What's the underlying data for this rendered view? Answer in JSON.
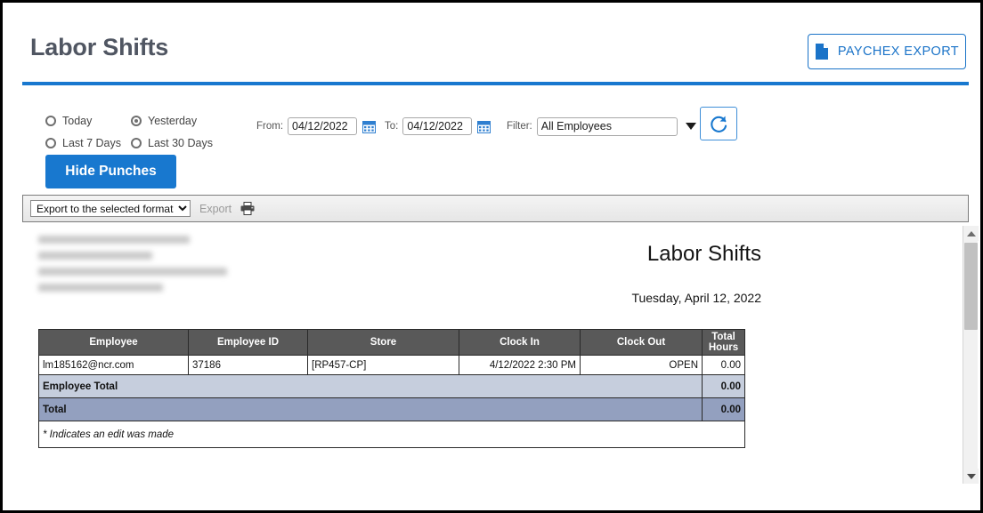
{
  "header": {
    "title": "Labor Shifts",
    "export_button": {
      "label": "PAYCHEX EXPORT",
      "icon": "file-icon"
    },
    "accent_color": "#1878cf",
    "title_color": "#505662"
  },
  "filters": {
    "range_options": [
      {
        "label": "Today",
        "selected": false
      },
      {
        "label": "Yesterday",
        "selected": true
      },
      {
        "label": "Last 7 Days",
        "selected": false
      },
      {
        "label": "Last 30 Days",
        "selected": false
      }
    ],
    "from_label": "From:",
    "from_value": "04/12/2022",
    "to_label": "To:",
    "to_value": "04/12/2022",
    "filter_label": "Filter:",
    "filter_value": "All Employees",
    "refresh_icon": "refresh-icon",
    "calendar_icon": "calendar-icon",
    "hide_punches_label": "Hide Punches"
  },
  "export_toolbar": {
    "format_select_value": "Export to the selected format",
    "export_label": "Export",
    "print_icon": "printer-icon"
  },
  "report": {
    "title": "Labor Shifts",
    "date": "Tuesday, April 12, 2022",
    "columns": [
      "Employee",
      "Employee ID",
      "Store",
      "Clock In",
      "Clock Out",
      "Total Hours"
    ],
    "total_hours_header_line1": "Total",
    "total_hours_header_line2": "Hours",
    "rows": [
      {
        "employee": "lm185162@ncr.com",
        "employee_id": "37186",
        "store": "[RP457-CP]",
        "clock_in": "4/12/2022 2:30 PM",
        "clock_out": "OPEN",
        "total_hours": "0.00"
      }
    ],
    "employee_total_label": "Employee Total",
    "employee_total_value": "0.00",
    "grand_total_label": "Total",
    "grand_total_value": "0.00",
    "footnote": "* Indicates an edit was made",
    "header_bg": "#595959",
    "employee_total_bg": "#c6cedd",
    "grand_total_bg": "#93a0bf"
  }
}
